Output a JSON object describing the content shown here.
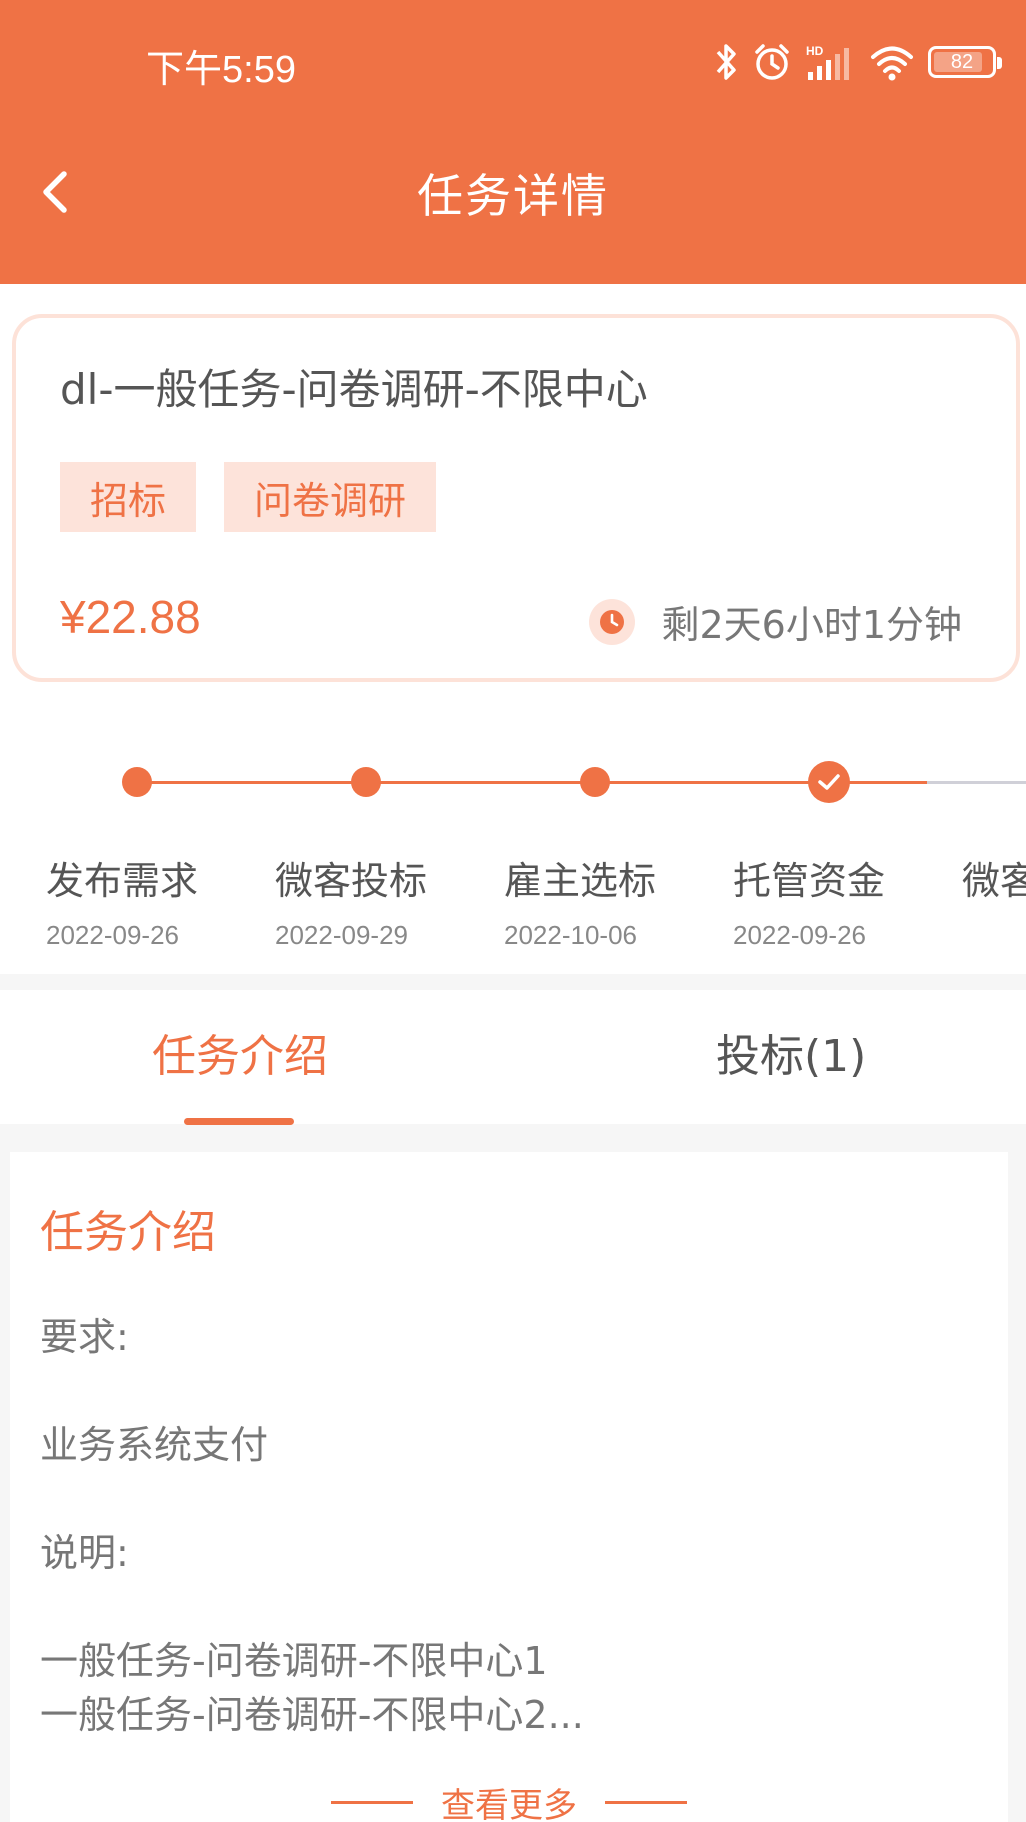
{
  "status_bar": {
    "time": "下午5:59",
    "battery": "82",
    "icons": [
      "bluetooth-icon",
      "alarm-icon",
      "hd-signal-icon",
      "wifi-icon",
      "battery-icon"
    ]
  },
  "nav": {
    "title": "任务详情",
    "back_icon": "chevron-left-icon"
  },
  "task": {
    "title": "dl-一般任务-问卷调研-不限中心",
    "tags": [
      "招标",
      "问卷调研"
    ],
    "price": "¥22.88",
    "remaining": "剩2天6小时1分钟"
  },
  "steps": [
    {
      "label": "发布需求",
      "date": "2022-09-26",
      "state": "done"
    },
    {
      "label": "微客投标",
      "date": "2022-09-29",
      "state": "done"
    },
    {
      "label": "雇主选标",
      "date": "2022-10-06",
      "state": "done"
    },
    {
      "label": "托管资金",
      "date": "2022-09-26",
      "state": "current"
    },
    {
      "label": "微客",
      "date": "",
      "state": "pending"
    }
  ],
  "tabs": [
    {
      "label": "任务介绍",
      "active": true
    },
    {
      "label": "投标(1)",
      "active": false
    }
  ],
  "intro": {
    "heading": "任务介绍",
    "lines": [
      "要求:",
      "业务系统支付",
      "说明:",
      "一般任务-问卷调研-不限中心1",
      "一般任务-问卷调研-不限中心2..."
    ],
    "more": "查看更多"
  },
  "colors": {
    "accent": "#ef7245",
    "tag_bg": "#fde3da",
    "pending_line": "#d0d0d8"
  }
}
